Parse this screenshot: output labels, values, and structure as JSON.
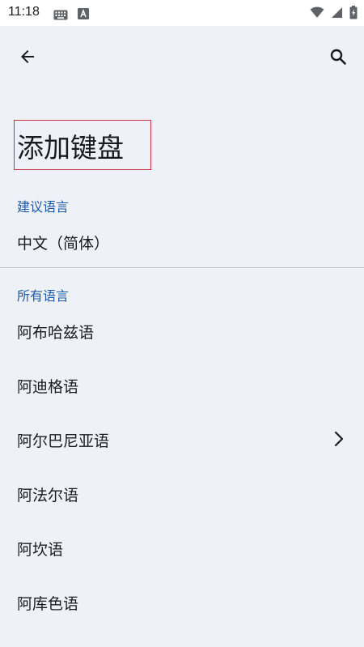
{
  "status_bar": {
    "time": "11:18",
    "icons": [
      "keyboard-icon",
      "a-letter-icon",
      "wifi-icon",
      "cell-signal-icon",
      "battery-icon"
    ]
  },
  "app_bar": {
    "back_icon": "arrow-back-icon",
    "search_icon": "search-icon"
  },
  "page": {
    "title": "添加键盘"
  },
  "suggested": {
    "header": "建议语言",
    "items": [
      {
        "label": "中文（简体）",
        "has_submenu": false
      }
    ]
  },
  "all_languages": {
    "header": "所有语言",
    "items": [
      {
        "label": "阿布哈兹语",
        "has_submenu": false
      },
      {
        "label": "阿迪格语",
        "has_submenu": false
      },
      {
        "label": "阿尔巴尼亚语",
        "has_submenu": true
      },
      {
        "label": "阿法尔语",
        "has_submenu": false
      },
      {
        "label": "阿坎语",
        "has_submenu": false
      },
      {
        "label": "阿库色语",
        "has_submenu": false
      }
    ]
  },
  "colors": {
    "background": "#eef1f8",
    "accent": "#1f5aa8",
    "highlight_box": "#c8323c"
  }
}
